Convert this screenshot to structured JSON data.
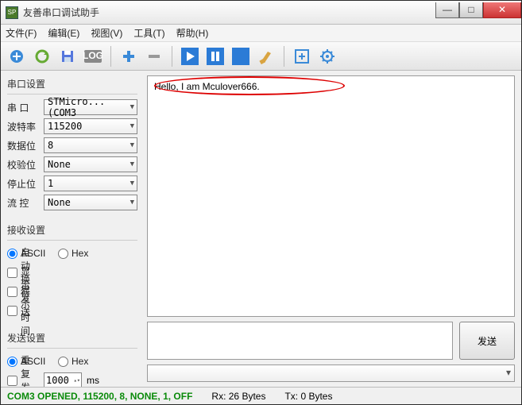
{
  "window": {
    "title": "友善串口调试助手"
  },
  "menu": {
    "file": "文件(F)",
    "edit": "编辑(E)",
    "view": "视图(V)",
    "tools": "工具(T)",
    "help": "帮助(H)"
  },
  "sidebar": {
    "serial": {
      "title": "串口设置",
      "port_label": "串  口",
      "port_value": "STMicro...(COM3",
      "baud_label": "波特率",
      "baud_value": "115200",
      "databits_label": "数据位",
      "databits_value": "8",
      "parity_label": "校验位",
      "parity_value": "None",
      "stopbits_label": "停止位",
      "stopbits_value": "1",
      "flow_label": "流  控",
      "flow_value": "None"
    },
    "recv": {
      "title": "接收设置",
      "ascii": "ASCII",
      "hex": "Hex",
      "autowrap": "自动换行",
      "showsend": "显示发送",
      "showtime": "显示时间"
    },
    "send": {
      "title": "发送设置",
      "ascii": "ASCII",
      "hex": "Hex",
      "repeat": "重复发送",
      "interval": "1000",
      "unit": "ms"
    }
  },
  "main": {
    "rx_text": "Hello, I am Mculover666.",
    "send_btn": "发送"
  },
  "status": {
    "conn": "COM3 OPENED, 115200, 8, NONE, 1, OFF",
    "rx": "Rx: 26 Bytes",
    "tx": "Tx: 0 Bytes"
  }
}
